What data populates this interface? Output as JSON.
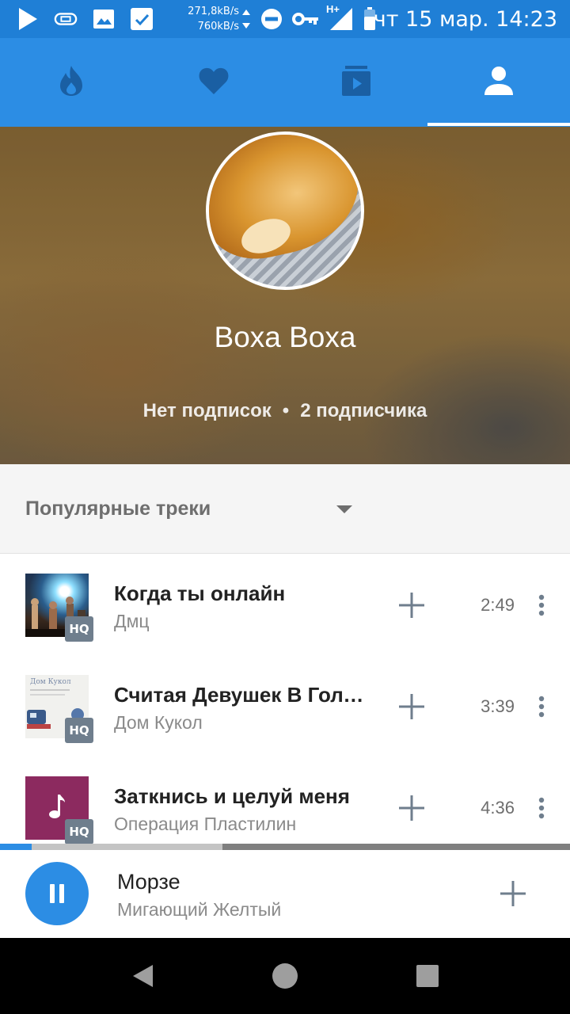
{
  "status_bar": {
    "speed_down": "271,8kB/s",
    "speed_up": "760kB/s",
    "network": "H+",
    "clock": "чт 15 мар. 14:23",
    "icons": [
      "play-store-icon",
      "usb-debug-icon",
      "image-icon",
      "check-task-icon",
      "data-arrows-icon",
      "do-not-disturb-icon",
      "vpn-key-icon",
      "signal-icon",
      "battery-icon"
    ]
  },
  "tabs": [
    {
      "name": "popular",
      "icon": "flame-icon"
    },
    {
      "name": "favorites",
      "icon": "heart-icon"
    },
    {
      "name": "playlists",
      "icon": "playlist-icon"
    },
    {
      "name": "profile",
      "icon": "user-icon",
      "active": true
    }
  ],
  "profile": {
    "name": "Boxa Boxa",
    "subscriptions": "Нет подписок",
    "separator": "•",
    "subscribers": "2 подписчика"
  },
  "section": {
    "title": "Популярные треки"
  },
  "tracks": [
    {
      "title": "Когда ты онлайн",
      "artist": "Дмц",
      "duration": "2:49",
      "hq": "HQ",
      "cover": "concert-photo"
    },
    {
      "title": "Считая Девушек В Голове",
      "artist": "Дом Кукол",
      "duration": "3:39",
      "hq": "HQ",
      "cover": "album-art",
      "cover_text": "Дом Кукол"
    },
    {
      "title": "Заткнись и целуй меня",
      "artist": "Операция Пластилин",
      "duration": "4:36",
      "hq": "HQ",
      "cover": "music-note-placeholder"
    }
  ],
  "player": {
    "title": "Морзе",
    "artist": "Мигающий Желтый",
    "state": "playing",
    "progress": 0.055,
    "buffered": 0.39
  },
  "colors": {
    "status_bar": "#1f7fd6",
    "tab_bar": "#2c8de4",
    "tab_icon_inactive": "#1a5fa3",
    "accent": "#2c8de4",
    "hq_badge": "#6f7e8d",
    "placeholder_cover": "#8c2a5f"
  }
}
